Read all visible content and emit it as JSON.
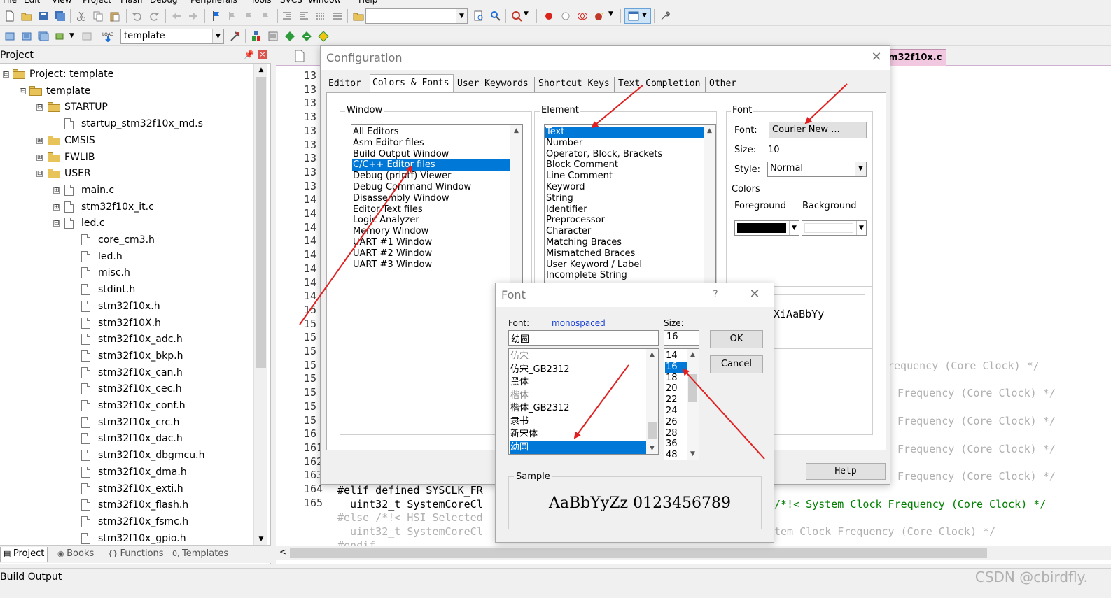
{
  "menu": [
    "File",
    "Edit",
    "View",
    "Project",
    "Flash",
    "Debug",
    "Peripherals",
    "Tools",
    "SVCS",
    "Window",
    "Help"
  ],
  "toolbar2": {
    "target_combo": "template"
  },
  "project_panel": {
    "title": "Project",
    "tree": [
      {
        "label": "Project: template",
        "depth": 0,
        "kind": "project",
        "expander": "⊟"
      },
      {
        "label": "template",
        "depth": 1,
        "kind": "target",
        "expander": "⊟"
      },
      {
        "label": "STARTUP",
        "depth": 2,
        "kind": "folder",
        "expander": "⊟"
      },
      {
        "label": "startup_stm32f10x_md.s",
        "depth": 3,
        "kind": "file",
        "expander": ""
      },
      {
        "label": "CMSIS",
        "depth": 2,
        "kind": "folder",
        "expander": "⊞"
      },
      {
        "label": "FWLIB",
        "depth": 2,
        "kind": "folder",
        "expander": "⊞"
      },
      {
        "label": "USER",
        "depth": 2,
        "kind": "folder",
        "expander": "⊟"
      },
      {
        "label": "main.c",
        "depth": 3,
        "kind": "file",
        "expander": "⊞"
      },
      {
        "label": "stm32f10x_it.c",
        "depth": 3,
        "kind": "file",
        "expander": "⊞"
      },
      {
        "label": "led.c",
        "depth": 3,
        "kind": "file",
        "expander": "⊟"
      },
      {
        "label": "core_cm3.h",
        "depth": 4,
        "kind": "file",
        "expander": ""
      },
      {
        "label": "led.h",
        "depth": 4,
        "kind": "file",
        "expander": ""
      },
      {
        "label": "misc.h",
        "depth": 4,
        "kind": "file",
        "expander": ""
      },
      {
        "label": "stdint.h",
        "depth": 4,
        "kind": "file",
        "expander": ""
      },
      {
        "label": "stm32f10x.h",
        "depth": 4,
        "kind": "file",
        "expander": ""
      },
      {
        "label": "stm32f10X.h",
        "depth": 4,
        "kind": "file",
        "expander": ""
      },
      {
        "label": "stm32f10x_adc.h",
        "depth": 4,
        "kind": "file",
        "expander": ""
      },
      {
        "label": "stm32f10x_bkp.h",
        "depth": 4,
        "kind": "file",
        "expander": ""
      },
      {
        "label": "stm32f10x_can.h",
        "depth": 4,
        "kind": "file",
        "expander": ""
      },
      {
        "label": "stm32f10x_cec.h",
        "depth": 4,
        "kind": "file",
        "expander": ""
      },
      {
        "label": "stm32f10x_conf.h",
        "depth": 4,
        "kind": "file",
        "expander": ""
      },
      {
        "label": "stm32f10x_crc.h",
        "depth": 4,
        "kind": "file",
        "expander": ""
      },
      {
        "label": "stm32f10x_dac.h",
        "depth": 4,
        "kind": "file",
        "expander": ""
      },
      {
        "label": "stm32f10x_dbgmcu.h",
        "depth": 4,
        "kind": "file",
        "expander": ""
      },
      {
        "label": "stm32f10x_dma.h",
        "depth": 4,
        "kind": "file",
        "expander": ""
      },
      {
        "label": "stm32f10x_exti.h",
        "depth": 4,
        "kind": "file",
        "expander": ""
      },
      {
        "label": "stm32f10x_flash.h",
        "depth": 4,
        "kind": "file",
        "expander": ""
      },
      {
        "label": "stm32f10x_fsmc.h",
        "depth": 4,
        "kind": "file",
        "expander": ""
      },
      {
        "label": "stm32f10x_gpio.h",
        "depth": 4,
        "kind": "file",
        "expander": ""
      }
    ],
    "tabs": [
      "Project",
      "Books",
      "Functions",
      "Templates"
    ],
    "tab_icons": [
      "project-icon",
      "books-icon",
      "functions-icon",
      "templates-icon"
    ]
  },
  "editor": {
    "active_tab": "m32f10x.c",
    "line_numbers": [
      "13",
      "13",
      "13",
      "13",
      "13",
      "13",
      "13",
      "13",
      "13",
      "14",
      "14",
      "14",
      "14",
      "14",
      "14",
      "14",
      "14",
      "15",
      "15",
      "15",
      "15",
      "15",
      "15",
      "15",
      "15",
      "15",
      "16",
      "161",
      "162",
      "163",
      "164",
      "165"
    ],
    "code_lines": [
      {
        "text": "#elif defined SYSCLK_FR",
        "color": "#000000"
      },
      {
        "text": "  uint32_t SystemCoreCl",
        "color": "#000000"
      },
      {
        "text": "#else /*!< HSI Selected",
        "color": "#b0b0b0"
      },
      {
        "text": "  uint32_t SystemCoreCl",
        "color": "#b0b0b0"
      },
      {
        "text": "#endif",
        "color": "#b0b0b0"
      }
    ],
    "right_comments": [
      {
        "text": "requency (Core Clock) */",
        "color": "#b0b0b0"
      },
      {
        "text": "Frequency (Core Clock) */",
        "color": "#b0b0b0"
      },
      {
        "text": "Frequency (Core Clock) */",
        "color": "#b0b0b0"
      },
      {
        "text": "Frequency (Core Clock) */",
        "color": "#b0b0b0"
      },
      {
        "text": "Frequency (Core Clock) */",
        "color": "#b0b0b0"
      },
      {
        "text": "/*!< System Clock Frequency (Core Clock) */",
        "color": "#008000"
      },
      {
        "text": "tem Clock Frequency (Core Clock) */",
        "color": "#b0b0b0"
      }
    ]
  },
  "status": {
    "build_output": "Build Output",
    "watermark": "CSDN @cbirdfly."
  },
  "config_dialog": {
    "title": "Configuration",
    "tabs": [
      "Editor",
      "Colors & Fonts",
      "User Keywords",
      "Shortcut Keys",
      "Text Completion",
      "Other"
    ],
    "active_tab": "Colors & Fonts",
    "window_group": "Window",
    "window_items": [
      "All Editors",
      "Asm Editor files",
      "Build Output Window",
      "C/C++ Editor files",
      "Debug (printf) Viewer",
      "Debug Command Window",
      "Disassembly Window",
      "Editor Text files",
      "Logic Analyzer",
      "Memory Window",
      "UART #1 Window",
      "UART #2 Window",
      "UART #3 Window"
    ],
    "window_selected": "C/C++ Editor files",
    "element_group": "Element",
    "element_items": [
      "Text",
      "Number",
      "Operator, Block, Brackets",
      "Block Comment",
      "Line Comment",
      "Keyword",
      "String",
      "Identifier",
      "Preprocessor",
      "Character",
      "Matching Braces",
      "Mismatched Braces",
      "User Keyword / Label",
      "Incomplete String"
    ],
    "element_selected": "Text",
    "font_group": "Font",
    "font_label": "Font:",
    "font_button": "Courier New ...",
    "size_label": "Size:",
    "size_value": "10",
    "style_label": "Style:",
    "style_value": "Normal",
    "colors_group": "Colors",
    "foreground_label": "Foreground",
    "background_label": "Background",
    "foreground_color": "#000000",
    "background_color": "#ffffff",
    "sample_text_partial": "XiAaBbYy",
    "help_button": "Help"
  },
  "font_dialog": {
    "title": "Font",
    "help_glyph": "?",
    "font_label": "Font:",
    "monospaced_label": "monospaced",
    "font_value": "幼圆",
    "font_items": [
      "仿宋",
      "仿宋_GB2312",
      "黑体",
      "楷体",
      "楷体_GB2312",
      "隶书",
      "新宋体",
      "幼圆"
    ],
    "font_selected": "幼圆",
    "size_label": "Size:",
    "size_value": "16",
    "size_items": [
      "14",
      "16",
      "18",
      "20",
      "22",
      "24",
      "26",
      "28",
      "36",
      "48"
    ],
    "size_selected": "16",
    "ok_button": "OK",
    "cancel_button": "Cancel",
    "sample_label": "Sample",
    "sample_text": "AaBbYyZz 0123456789"
  },
  "annotation_color": "#e02020"
}
